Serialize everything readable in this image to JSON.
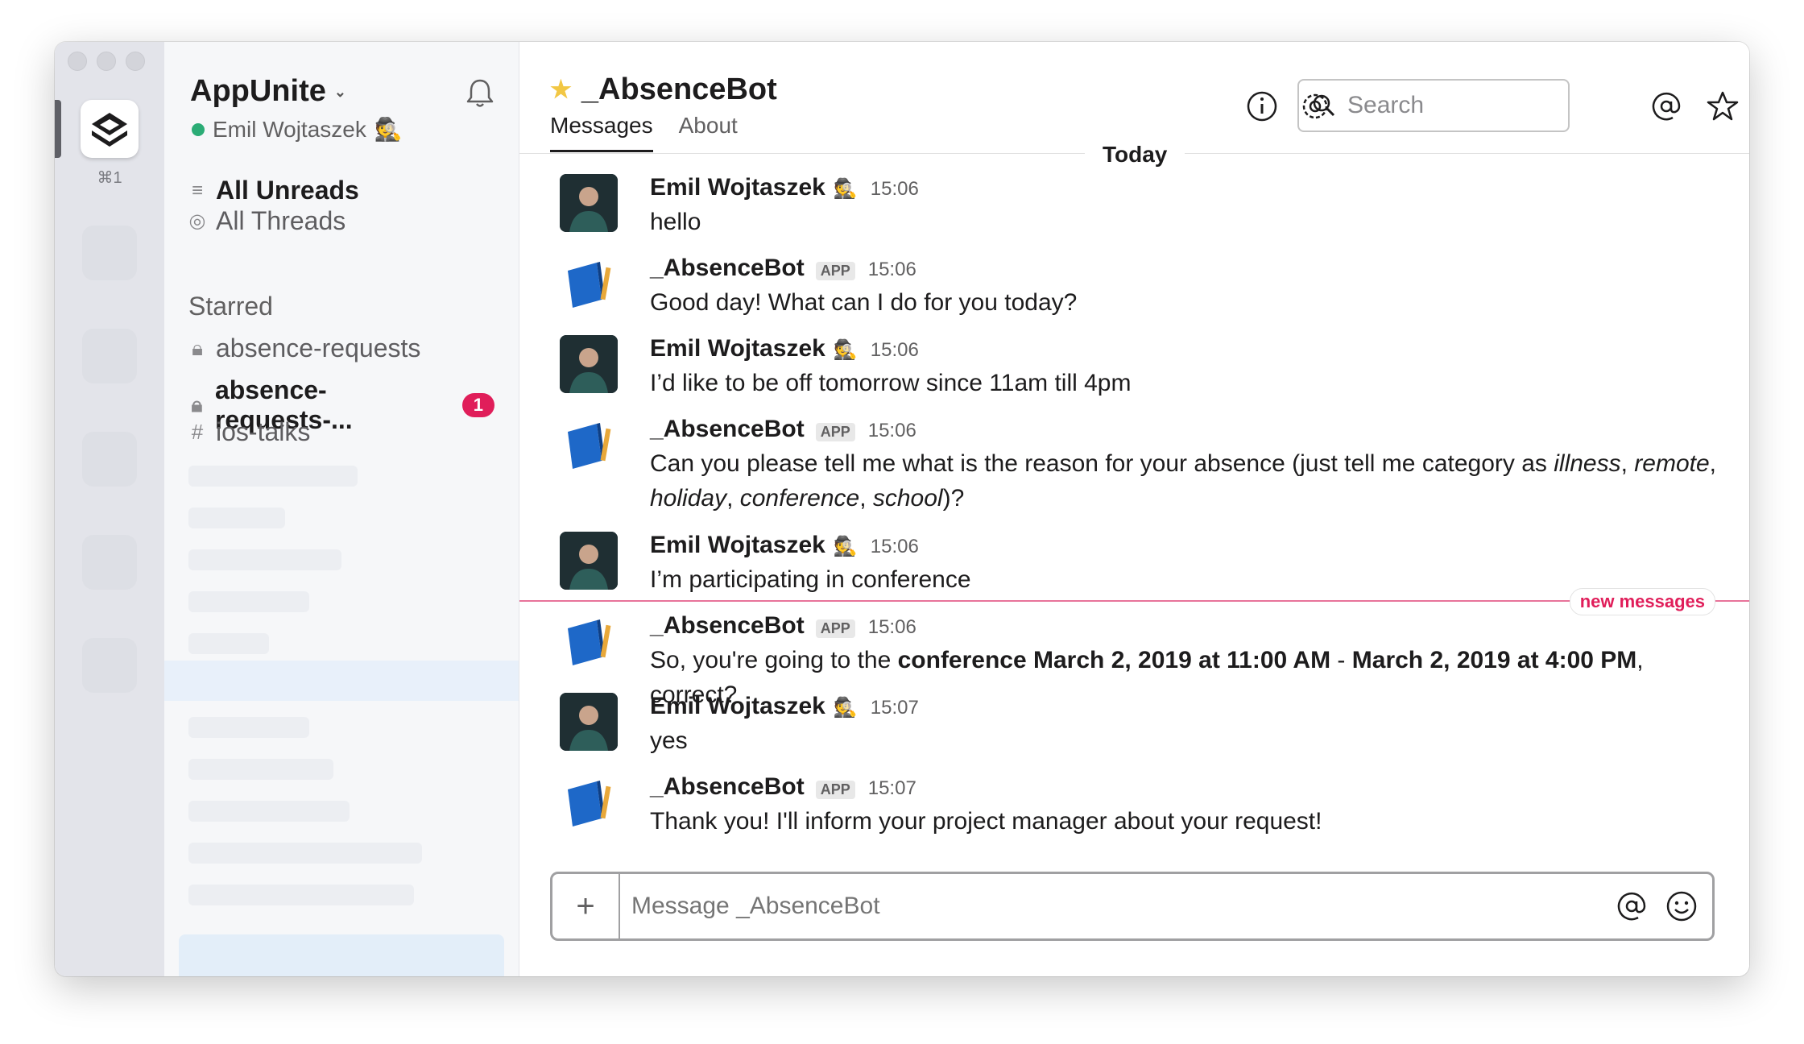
{
  "team_switcher": {
    "shortcut": "⌘1"
  },
  "sidebar": {
    "team_name": "AppUnite",
    "user_name": "Emil Wojtaszek",
    "user_status_emoji": "🕵",
    "nav": [
      {
        "label": "All Unreads",
        "icon": "list-icon"
      },
      {
        "label": "All Threads",
        "icon": "threads-icon"
      }
    ],
    "starred_label": "Starred",
    "channels": [
      {
        "name": "absence-requests",
        "private": true,
        "unread": false,
        "badge": ""
      },
      {
        "name": "absence-requests-...",
        "private": true,
        "unread": true,
        "badge": "1"
      },
      {
        "name": "ios-talks",
        "private": false,
        "unread": false,
        "badge": ""
      }
    ]
  },
  "header": {
    "channel_name": "_AbsenceBot",
    "starred": true,
    "tabs": [
      "Messages",
      "About"
    ],
    "active_tab": "Messages",
    "search_placeholder": "Search"
  },
  "day_divider": "Today",
  "new_messages_label": "new messages",
  "messages": [
    {
      "sender": "Emil Wojtaszek",
      "status": "🕵",
      "app": false,
      "time": "15:06",
      "text": "hello"
    },
    {
      "sender": "_AbsenceBot",
      "app": true,
      "app_tag": "APP",
      "time": "15:06",
      "text": "Good day! What can I do for you today?"
    },
    {
      "sender": "Emil Wojtaszek",
      "status": "🕵",
      "app": false,
      "time": "15:06",
      "text": "I’d like to be off tomorrow since 11am till 4pm"
    },
    {
      "sender": "_AbsenceBot",
      "app": true,
      "app_tag": "APP",
      "time": "15:06",
      "text_1": "Can you please tell me what is the reason for your absence (just tell me category as ",
      "italic_1": "illness",
      "sep_1": ", ",
      "italic_2": "remote",
      "sep_2": ",",
      "italic_3": "holiday",
      "sep_3": ", ",
      "italic_4": "conference",
      "sep_4": ", ",
      "italic_5": "school",
      "text_2": ")?"
    },
    {
      "sender": "Emil Wojtaszek",
      "status": "🕵",
      "app": false,
      "time": "15:06",
      "text": "I’m participating in conference"
    },
    {
      "sender": "_AbsenceBot",
      "app": true,
      "app_tag": "APP",
      "time": "15:06",
      "text_1": "So, you're going to the ",
      "bold_1": "conference March 2, 2019 at 11:00 AM",
      "text_2": " - ",
      "bold_2": "March 2, 2019 at 4:00 PM",
      "text_3": ", correct?"
    },
    {
      "sender": "Emil Wojtaszek",
      "status": "🕵",
      "app": false,
      "time": "15:07",
      "text": "yes"
    },
    {
      "sender": "_AbsenceBot",
      "app": true,
      "app_tag": "APP",
      "time": "15:07",
      "text": "Thank you! I'll inform your project manager about your request!"
    }
  ],
  "composer": {
    "placeholder": "Message _AbsenceBot"
  },
  "colors": {
    "accent_red": "#e01e5a",
    "presence_green": "#2bac76",
    "star_yellow": "#f2c744"
  }
}
